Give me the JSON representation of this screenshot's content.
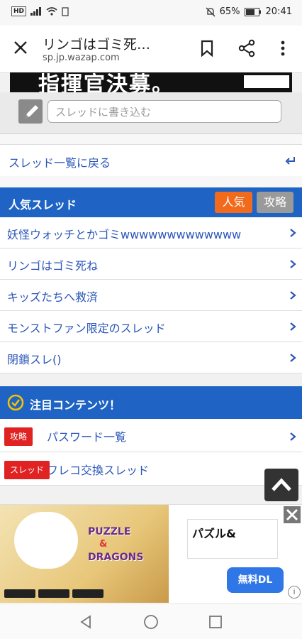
{
  "statusbar": {
    "hd": "HD",
    "battery": "65%",
    "time": "20:41"
  },
  "browser": {
    "title": "リンゴはゴミ死…",
    "url": "sp.jp.wazap.com"
  },
  "banner": {
    "text": "指揮官決募。",
    "badge": ""
  },
  "post": {
    "placeholder": "スレッドに書き込む"
  },
  "back": {
    "label": "スレッド一覧に戻る"
  },
  "popular": {
    "title": "人気スレッド",
    "tab_popular": "人気",
    "tab_guide": "攻略",
    "items": [
      "妖怪ウォッチとかゴミwwwwwwwwwwwww",
      "リンゴはゴミ死ね",
      "キッズたちへ救済",
      "モンストファン限定のスレッド",
      "閉鎖スレ()"
    ]
  },
  "featured": {
    "title": "注目コンテンツ！",
    "items": [
      {
        "tag": "攻略",
        "label": "パスワード一覧"
      },
      {
        "tag": "スレッド",
        "label": "フレコ交換スレッド"
      }
    ]
  },
  "ad": {
    "puzzle": "PUZZLE",
    "and": "&",
    "dragons": "DRAGONS",
    "title": "パズル&",
    "download": "無料DL",
    "info": "i"
  },
  "colors": {
    "accent": "#1f64c4",
    "link": "#2a56b8",
    "orange": "#f26b1d",
    "red": "#e02222"
  }
}
